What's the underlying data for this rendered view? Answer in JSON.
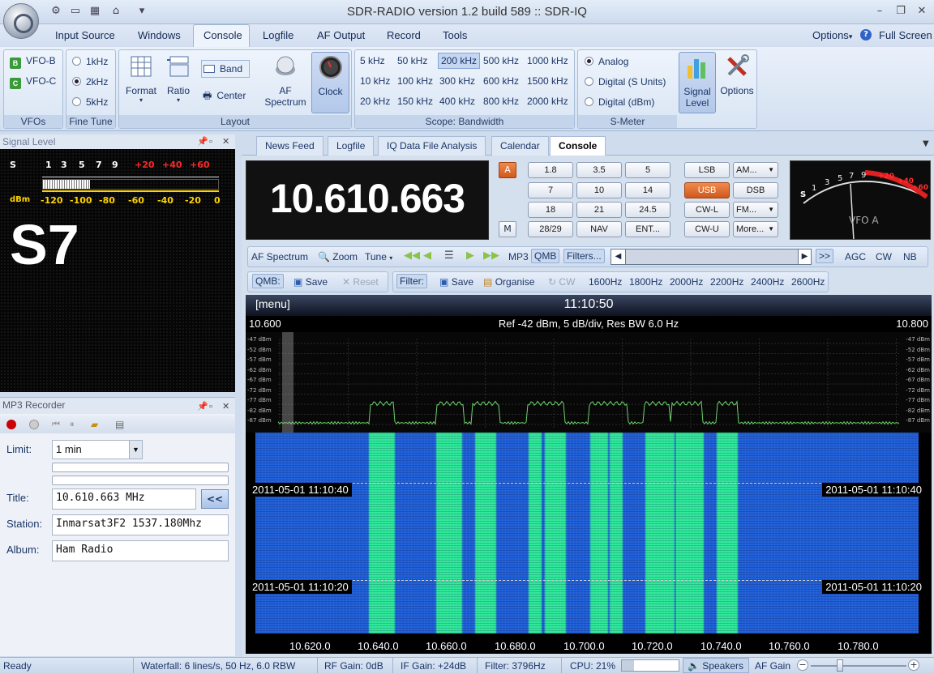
{
  "window": {
    "title": "SDR-RADIO version 1.2  build 589 :: SDR-IQ",
    "min": "–",
    "restore": "❐",
    "close": "✕"
  },
  "menu": {
    "items": [
      "Input Source",
      "Windows",
      "Console",
      "Logfile",
      "AF Output",
      "Record",
      "Tools"
    ],
    "right_options": "Options",
    "help": "?",
    "full_screen": "Full Screen"
  },
  "ribbon": {
    "vfos": {
      "items": [
        "VFO-B",
        "VFO-C"
      ],
      "label": "VFOs"
    },
    "fine_tune": {
      "items": [
        "1kHz",
        "2kHz",
        "5kHz"
      ],
      "selected": "2kHz",
      "label": "Fine Tune"
    },
    "layout": {
      "format": "Format",
      "ratio": "Ratio",
      "band": "Band",
      "center": "Center",
      "af_spectrum": "AF\nSpectrum",
      "clock": "Clock",
      "label": "Layout"
    },
    "bandwidth": {
      "rows": [
        [
          "5 kHz",
          "50 kHz",
          "200 kHz",
          "500 kHz",
          "1000 kHz"
        ],
        [
          "10 kHz",
          "100 kHz",
          "300 kHz",
          "600 kHz",
          "1500 kHz"
        ],
        [
          "20 kHz",
          "150 kHz",
          "400 kHz",
          "800 kHz",
          "2000 kHz"
        ]
      ],
      "selected": "200 kHz",
      "label": "Scope: Bandwidth"
    },
    "smeter": {
      "items": [
        "Analog",
        "Digital (S Units)",
        "Digital (dBm)"
      ],
      "selected": "Analog",
      "label": "S-Meter"
    },
    "signal_level": "Signal Level",
    "options": "Options"
  },
  "signal_panel": {
    "title": "Signal Level",
    "s_label": "S",
    "dbm_label": "dBm",
    "s_scale": [
      "1",
      "3",
      "5",
      "7",
      "9"
    ],
    "plus_scale": [
      "+20",
      "+40",
      "+60"
    ],
    "dbm_scale": [
      "-120",
      "-100",
      "-80",
      "-60",
      "-40",
      "-20",
      "0"
    ],
    "reading": "S7",
    "meter_fraction": 0.27
  },
  "mp3": {
    "title": "MP3 Recorder",
    "limit_label": "Limit:",
    "limit_value": "1 min",
    "title_label": "Title:",
    "title_value": "10.610.663 MHz",
    "title_btn": "<<",
    "station_label": "Station:",
    "station_value": "Inmarsat3F2 1537.180Mhz",
    "album_label": "Album:",
    "album_value": "Ham Radio"
  },
  "tabs": [
    "News Feed",
    "Logfile",
    "IQ Data File Analysis",
    "Calendar",
    "Console"
  ],
  "active_tab": "Console",
  "console": {
    "frequency": "10.610.663",
    "a_btn": "A",
    "m_btn": "M",
    "keys": [
      "1.8",
      "3.5",
      "5",
      "7",
      "10",
      "14",
      "18",
      "21",
      "24.5",
      "28/29",
      "NAV",
      "ENT..."
    ],
    "modes": [
      "LSB",
      "AM...",
      "USB",
      "DSB",
      "CW-L",
      "FM...",
      "CW-U",
      "More..."
    ],
    "selected_mode": "USB",
    "vfo_label": "VFO A",
    "meter_s": [
      "1",
      "3",
      "5",
      "7",
      "9"
    ],
    "meter_plus": [
      "+20",
      "+40",
      "+60"
    ],
    "meter_s_letter": "S"
  },
  "toolbar1": {
    "af_spectrum": "AF Spectrum",
    "zoom": "Zoom",
    "tune": "Tune",
    "mp3": "MP3",
    "qmb": "QMB",
    "filters": "Filters...",
    "more": ">>",
    "agc": "AGC",
    "cw": "CW",
    "nb": "NB"
  },
  "toolbar2": {
    "qmb": "QMB:",
    "save": "Save",
    "reset": "Reset",
    "filter": "Filter:",
    "save2": "Save",
    "organise": "Organise",
    "cw": "CW",
    "filters": [
      "1600Hz",
      "1800Hz",
      "2000Hz",
      "2200Hz",
      "2400Hz",
      "2600Hz"
    ]
  },
  "scope": {
    "menu": "[menu]",
    "clock": "11:10:50",
    "left_freq": "10.600",
    "right_freq": "10.800",
    "info": "Ref -42 dBm,  5 dB/div,  Res BW 6.0 Hz",
    "dbm_ticks": [
      "-47 dBm",
      "-52 dBm",
      "-57 dBm",
      "-62 dBm",
      "-67 dBm",
      "-72 dBm",
      "-77 dBm",
      "-82 dBm",
      "-87 dBm"
    ],
    "stamps": [
      "2011-05-01  11:10:40",
      "2011-05-01  11:10:20"
    ],
    "freq_axis": [
      "10.620.0",
      "10.640.0",
      "10.660.0",
      "10.680.0",
      "10.700.0",
      "10.720.0",
      "10.740.0",
      "10.760.0",
      "10.780.0"
    ]
  },
  "status": {
    "ready": "Ready",
    "waterfall": "Waterfall: 6 lines/s, 50 Hz, 6.0 RBW",
    "rf_gain": "RF Gain: 0dB",
    "if_gain": "IF Gain: +24dB",
    "filter": "Filter: 3796Hz",
    "cpu": "CPU: 21%",
    "speakers": "Speakers",
    "af_gain": "AF Gain"
  },
  "colors": {
    "accent_orange": "#e06a28",
    "ribbon_blue": "#d3e0f1",
    "waterfall_blue": "#1f5fd8",
    "waterfall_green": "#2ee89a",
    "trace_green": "#6cd36c"
  }
}
